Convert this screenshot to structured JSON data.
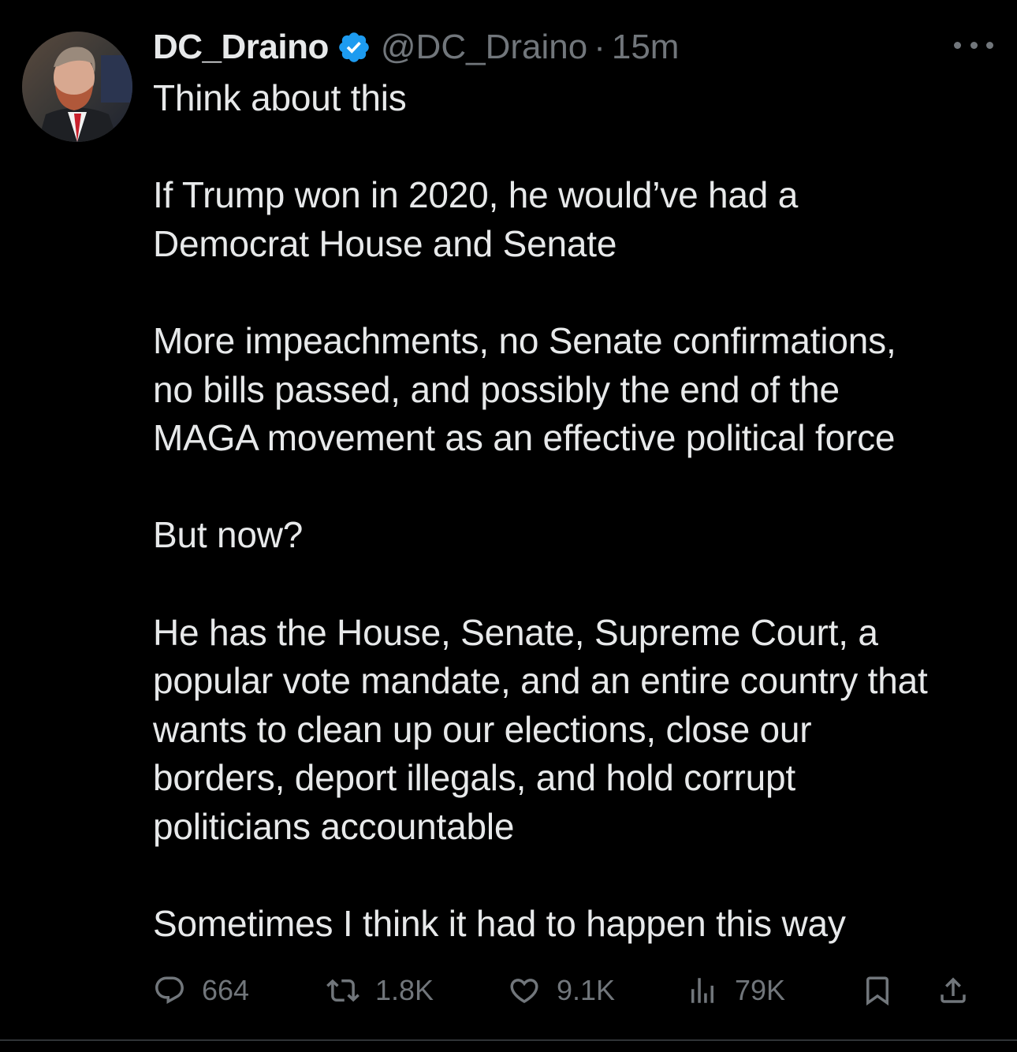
{
  "tweet": {
    "display_name": "DC_Draino",
    "handle": "@DC_Draino",
    "separator": "·",
    "timestamp": "15m",
    "paragraphs": [
      "Think about this",
      "If Trump won in 2020, he would’ve had a\nDemocrat House and Senate",
      "More impeachments, no Senate confirmations,\nno bills passed, and possibly the end of the\nMAGA movement as an effective political force",
      "But now?",
      "He has the House, Senate, Supreme Court, a\npopular vote mandate, and an entire country that\nwants to clean up our elections, close our\nborders, deport illegals, and hold corrupt\npoliticians accountable",
      "Sometimes I think it had to happen this way"
    ]
  },
  "actions": {
    "replies": "664",
    "reposts": "1.8K",
    "likes": "9.1K",
    "views": "79K"
  },
  "icons": {
    "verified": "verified-badge-icon",
    "more": "more-options-icon",
    "reply": "reply-icon",
    "repost": "repost-icon",
    "like": "heart-icon",
    "views": "views-chart-icon",
    "bookmark": "bookmark-icon",
    "share": "share-icon"
  },
  "colors": {
    "background": "#000000",
    "text": "#e7e9ea",
    "secondary": "#71767b",
    "verified": "#1d9bf0"
  }
}
